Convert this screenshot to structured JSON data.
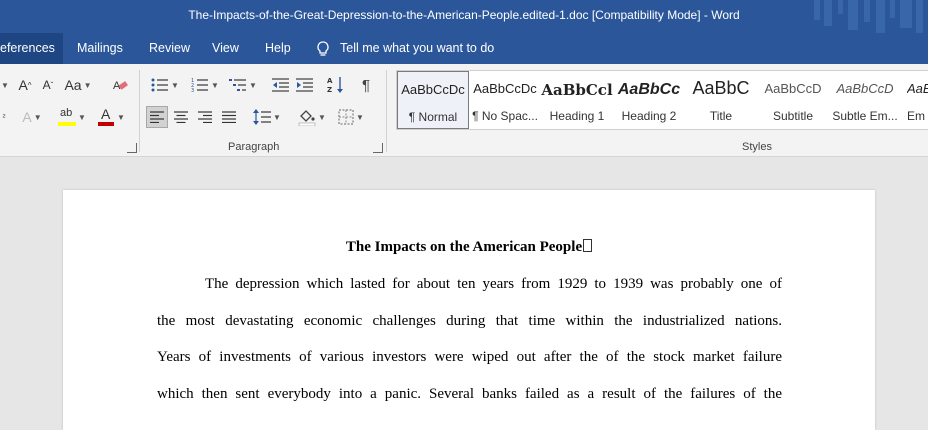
{
  "window": {
    "title": "The-Impacts-of-the-Great-Depression-to-the-American-People.edited-1.doc [Compatibility Mode]  -  Word"
  },
  "tabs": [
    {
      "label": "eferences"
    },
    {
      "label": "Mailings"
    },
    {
      "label": "Review"
    },
    {
      "label": "View"
    },
    {
      "label": "Help"
    }
  ],
  "tell_me": {
    "text": "Tell me what you want to do"
  },
  "ribbon": {
    "font_group": {
      "grow_font": "A",
      "shrink_font": "A",
      "change_case": "Aa",
      "text_effects": "A",
      "font_color": "A",
      "highlight": "ab"
    },
    "paragraph_group": {
      "label": "Paragraph"
    },
    "styles_group": {
      "label": "Styles",
      "items": [
        {
          "sample": "AaBbCcDc",
          "name": "¶ Normal"
        },
        {
          "sample": "AaBbCcDc",
          "name": "¶ No Spac..."
        },
        {
          "sample": "AaBbCcl",
          "name": "Heading 1"
        },
        {
          "sample": "AaBbCc",
          "name": "Heading 2"
        },
        {
          "sample": "AaBbC",
          "name": "Title"
        },
        {
          "sample": "AaBbCcD",
          "name": "Subtitle"
        },
        {
          "sample": "AaBbCcD",
          "name": "Subtle Em..."
        },
        {
          "sample": "AaBl",
          "name": "Em"
        }
      ]
    }
  },
  "colors": {
    "accent": "#2b579a",
    "highlight": "#ffff00",
    "font_color": "#c00000"
  },
  "document": {
    "title": "The Impacts on the American People",
    "lines": [
      "The depression which lasted for about ten years from 1929 to 1939 was probably one of",
      "the most devastating economic challenges during that time within the industrialized nations.",
      "Years of investments of various investors were wiped out after the of the stock market failure",
      "which then sent everybody into a panic. Several banks failed as a result of the failures of the"
    ]
  }
}
